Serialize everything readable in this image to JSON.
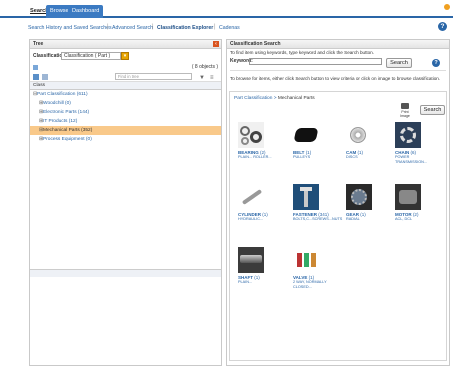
{
  "tabs": [
    {
      "label": "Search",
      "active": true
    },
    {
      "label": "Browse",
      "active": false
    },
    {
      "label": "Dashboard",
      "active": false
    }
  ],
  "subnav": {
    "history": "Search History and Saved Searches",
    "advanced": "Advanced Search",
    "explorer": "Classification Explorer",
    "cadenas": "Cadenas"
  },
  "tree": {
    "panel_title": "Tree",
    "classification_label": "Classification:",
    "classification_value": "Classification ( Part )",
    "object_count": "( 8 objects )",
    "find_placeholder": "Find in tree",
    "column_header": "Class",
    "items": [
      {
        "label": "Part Classification (611)",
        "level": 0,
        "selected": false
      },
      {
        "label": "Woodchill (0)",
        "level": 1,
        "selected": false
      },
      {
        "label": "Electronic Parts (144)",
        "level": 1,
        "selected": false
      },
      {
        "label": "IT Products (12)",
        "level": 1,
        "selected": false
      },
      {
        "label": "Mechanical Parts (352)",
        "level": 1,
        "selected": true
      },
      {
        "label": "Process Equipment (0)",
        "level": 1,
        "selected": false
      }
    ]
  },
  "search": {
    "panel_title": "Classification Search",
    "instruction": "To find item using keywords, type keyword and click the Search button.",
    "keyword_label": "Keyword:",
    "keyword_value": "",
    "search_label": "Search",
    "browse_instruction": "To browse for items, either click Search button to view criteria or click on image to browse classification."
  },
  "browse": {
    "crumb_root": "Part Classification",
    "crumb_sep": ">",
    "crumb_current": "Mechanical Parts",
    "print_label": "Print Image",
    "search_label": "Search",
    "cards": [
      {
        "title": "BEARING",
        "count": "(2)",
        "sub": "PLAIN... ROLLER..."
      },
      {
        "title": "BELT",
        "count": "(1)",
        "sub": "PULLEYS"
      },
      {
        "title": "CAM",
        "count": "(1)",
        "sub": "DISCS"
      },
      {
        "title": "CHAIN",
        "count": "(6)",
        "sub": "POWER TRANSMISSION..."
      },
      {
        "title": "CYLINDER",
        "count": "(1)",
        "sub": "HYDRAULIC..."
      },
      {
        "title": "FASTENER",
        "count": "(341)",
        "sub": "BOLTS,C...SCREWS...NUTS"
      },
      {
        "title": "GEAR",
        "count": "(1)",
        "sub": "RADIAL"
      },
      {
        "title": "MOTOR",
        "count": "(2)",
        "sub": "ACL, DCL"
      },
      {
        "title": "SHAFT",
        "count": "(1)",
        "sub": "PLAIN..."
      },
      {
        "title": "VALVE",
        "count": "(1)",
        "sub": "2 WAY, NORMALLY CLOSED..."
      }
    ]
  }
}
